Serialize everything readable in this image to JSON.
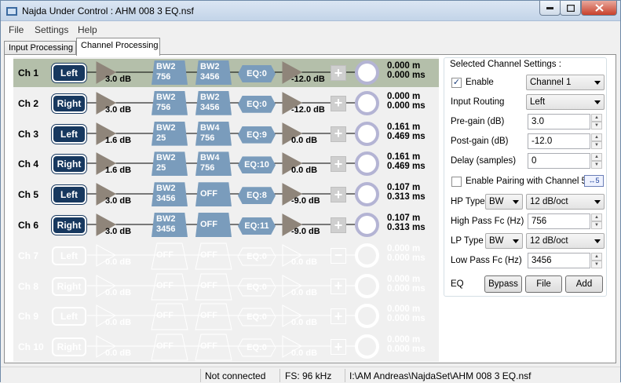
{
  "window": {
    "title": "Najda Under Control : AHM 008 3 EQ.nsf"
  },
  "menu": {
    "file": "File",
    "settings": "Settings",
    "help": "Help"
  },
  "tabs": {
    "input": "Input Processing",
    "channel": "Channel Processing"
  },
  "channels": [
    {
      "name": "Ch 1",
      "source": "Left",
      "pregain": "3.0 dB",
      "f1": [
        "BW2",
        "756"
      ],
      "f2": [
        "BW2",
        "3456"
      ],
      "eq": "EQ:0",
      "postgain": "-12.0 dB",
      "dist_m": "0.000 m",
      "dist_ms": "0.000 ms",
      "active": true,
      "selected": true,
      "button": "+"
    },
    {
      "name": "Ch 2",
      "source": "Right",
      "pregain": "3.0 dB",
      "f1": [
        "BW2",
        "756"
      ],
      "f2": [
        "BW2",
        "3456"
      ],
      "eq": "EQ:0",
      "postgain": "-12.0 dB",
      "dist_m": "0.000 m",
      "dist_ms": "0.000 ms",
      "active": true,
      "button": "+"
    },
    {
      "name": "Ch 3",
      "source": "Left",
      "pregain": "1.6 dB",
      "f1": [
        "BW2",
        "25"
      ],
      "f2": [
        "BW4",
        "756"
      ],
      "eq": "EQ:9",
      "postgain": "0.0 dB",
      "dist_m": "0.161 m",
      "dist_ms": "0.469 ms",
      "active": true,
      "button": "+"
    },
    {
      "name": "Ch 4",
      "source": "Right",
      "pregain": "1.6 dB",
      "f1": [
        "BW2",
        "25"
      ],
      "f2": [
        "BW4",
        "756"
      ],
      "eq": "EQ:10",
      "postgain": "0.0 dB",
      "dist_m": "0.161 m",
      "dist_ms": "0.469 ms",
      "active": true,
      "button": "+"
    },
    {
      "name": "Ch 5",
      "source": "Left",
      "pregain": "3.0 dB",
      "f1": [
        "BW2",
        "3456"
      ],
      "f2": [
        "OFF"
      ],
      "eq": "EQ:8",
      "postgain": "-9.0 dB",
      "dist_m": "0.107 m",
      "dist_ms": "0.313 ms",
      "active": true,
      "button": "+"
    },
    {
      "name": "Ch 6",
      "source": "Right",
      "pregain": "3.0 dB",
      "f1": [
        "BW2",
        "3456"
      ],
      "f2": [
        "OFF"
      ],
      "eq": "EQ:11",
      "postgain": "-9.0 dB",
      "dist_m": "0.107 m",
      "dist_ms": "0.313 ms",
      "active": true,
      "button": "+"
    },
    {
      "name": "Ch 7",
      "source": "Left",
      "pregain": "0.0 dB",
      "f1": [
        "OFF"
      ],
      "f2": [
        "OFF"
      ],
      "eq": "EQ:0",
      "postgain": "0.0 dB",
      "dist_m": "0.000 m",
      "dist_ms": "0.000 ms",
      "active": false,
      "button": "−"
    },
    {
      "name": "Ch 8",
      "source": "Right",
      "pregain": "0.0 dB",
      "f1": [
        "OFF"
      ],
      "f2": [
        "OFF"
      ],
      "eq": "EQ:0",
      "postgain": "0.0 dB",
      "dist_m": "0.000 m",
      "dist_ms": "0.000 ms",
      "active": false,
      "button": "+"
    },
    {
      "name": "Ch 9",
      "source": "Left",
      "pregain": "0.0 dB",
      "f1": [
        "OFF"
      ],
      "f2": [
        "OFF"
      ],
      "eq": "EQ:0",
      "postgain": "0.0 dB",
      "dist_m": "0.000 m",
      "dist_ms": "0.000 ms",
      "active": false,
      "button": "+"
    },
    {
      "name": "Ch 10",
      "source": "Right",
      "pregain": "0.0 dB",
      "f1": [
        "OFF"
      ],
      "f2": [
        "OFF"
      ],
      "eq": "EQ:0",
      "postgain": "0.0 dB",
      "dist_m": "0.000 m",
      "dist_ms": "0.000 ms",
      "active": false,
      "button": "+"
    }
  ],
  "settings": {
    "title": "Selected Channel Settings :",
    "enable_label": "Enable",
    "enable_checked": true,
    "channel_select": "Channel 1",
    "input_routing_label": "Input Routing",
    "input_routing": "Left",
    "pregain_label": "Pre-gain (dB)",
    "pregain": "3.0",
    "postgain_label": "Post-gain (dB)",
    "postgain": "-12.0",
    "delay_label": "Delay (samples)",
    "delay": "0",
    "pairing_label": "Enable Pairing with Channel 5",
    "pairing_checked": false,
    "pairing_icon": "↔5",
    "hp_type_label": "HP Type",
    "hp_type": "BW",
    "hp_slope": "12 dB/oct",
    "hp_fc_label": "High Pass Fc (Hz)",
    "hp_fc": "756",
    "lp_type_label": "LP Type",
    "lp_type": "BW",
    "lp_slope": "12 dB/oct",
    "lp_fc_label": "Low Pass Fc (Hz)",
    "lp_fc": "3456",
    "eq_label": "EQ",
    "bypass": "Bypass",
    "file": "File",
    "add": "Add"
  },
  "status": {
    "connection": "Not connected",
    "fs": "FS: 96 kHz",
    "path": "I:\\AM Andreas\\NajdaSet\\AHM 008 3 EQ.nsf"
  },
  "colors": {
    "accent": "#17385f",
    "filter": "#7a9cbc",
    "selected_row": "#b4bfaa",
    "amp": "#8f857a",
    "ring": "#b4b4d4"
  }
}
